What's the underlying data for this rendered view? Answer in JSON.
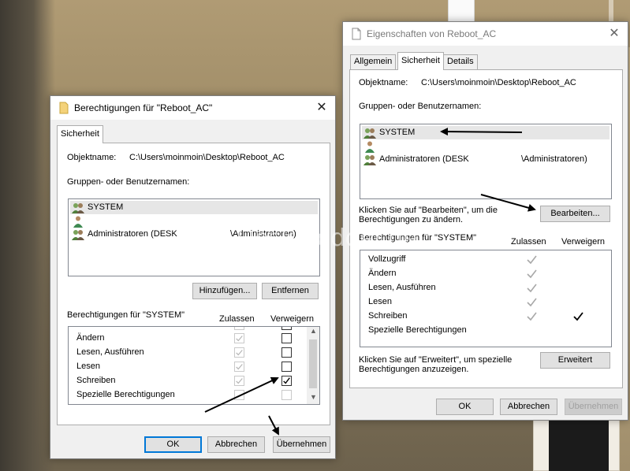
{
  "watermark": "Deskmodder.de",
  "colors": {
    "accent": "#0078d7",
    "arrow": "#000000",
    "list_selected": "#e6e6e6"
  },
  "left_window": {
    "title": "Berechtigungen für \"Reboot_AC\"",
    "tab": "Sicherheit",
    "object_label": "Objektname:",
    "object_value": "C:\\Users\\moinmoin\\Desktop\\Reboot_AC",
    "groups_label": "Gruppen- oder Benutzernamen:",
    "users": [
      {
        "name": "SYSTEM",
        "icon": "group-users-icon",
        "selected": true
      },
      {
        "name": "",
        "icon": "user-icon",
        "selected": false
      },
      {
        "name": "Administratoren (DESK",
        "suffix": "\\Administratoren)",
        "icon": "group-users-icon",
        "selected": false
      }
    ],
    "add_button": "Hinzufügen...",
    "remove_button": "Entfernen",
    "permissions_label": "Berechtigungen für \"SYSTEM\"",
    "allow_header": "Zulassen",
    "deny_header": "Verweigern",
    "permissions": [
      {
        "name": "Ändern",
        "allow": true,
        "deny": false
      },
      {
        "name": "Lesen, Ausführen",
        "allow": true,
        "deny": false
      },
      {
        "name": "Lesen",
        "allow": true,
        "deny": false
      },
      {
        "name": "Schreiben",
        "allow": true,
        "deny": true
      },
      {
        "name": "Spezielle Berechtigungen",
        "allow": false,
        "deny": false
      }
    ],
    "ok_button": "OK",
    "cancel_button": "Abbrechen",
    "apply_button": "Übernehmen"
  },
  "right_window": {
    "title": "Eigenschaften von Reboot_AC",
    "tabs": [
      "Allgemein",
      "Sicherheit",
      "Details"
    ],
    "active_tab": "Sicherheit",
    "object_label": "Objektname:",
    "object_value": "C:\\Users\\moinmoin\\Desktop\\Reboot_AC",
    "groups_label": "Gruppen- oder Benutzernamen:",
    "users": [
      {
        "name": "SYSTEM",
        "icon": "group-users-icon",
        "selected": true
      },
      {
        "name": "",
        "icon": "user-icon",
        "selected": false
      },
      {
        "name": "Administratoren (DESK",
        "suffix": "\\Administratoren)",
        "icon": "group-users-icon",
        "selected": false
      }
    ],
    "edit_hint": "Klicken Sie auf \"Bearbeiten\", um die Berechtigungen zu ändern.",
    "edit_hint_line1": "Klicken Sie auf \"Bearbeiten\", um die",
    "edit_hint_line2": "Berechtigungen zu ändern.",
    "edit_button": "Bearbeiten...",
    "permissions_label": "Berechtigungen für \"SYSTEM\"",
    "allow_header": "Zulassen",
    "deny_header": "Verweigern",
    "permissions": [
      {
        "name": "Vollzugriff",
        "allow": true,
        "deny": false
      },
      {
        "name": "Ändern",
        "allow": true,
        "deny": false
      },
      {
        "name": "Lesen, Ausführen",
        "allow": true,
        "deny": false
      },
      {
        "name": "Lesen",
        "allow": true,
        "deny": false
      },
      {
        "name": "Schreiben",
        "allow": true,
        "deny": true
      },
      {
        "name": "Spezielle Berechtigungen",
        "allow": false,
        "deny": false
      }
    ],
    "advanced_hint_line1": "Klicken Sie auf \"Erweitert\", um spezielle",
    "advanced_hint_line2": "Berechtigungen anzuzeigen.",
    "advanced_button": "Erweitert",
    "ok_button": "OK",
    "cancel_button": "Abbrechen",
    "apply_button": "Übernehmen"
  }
}
